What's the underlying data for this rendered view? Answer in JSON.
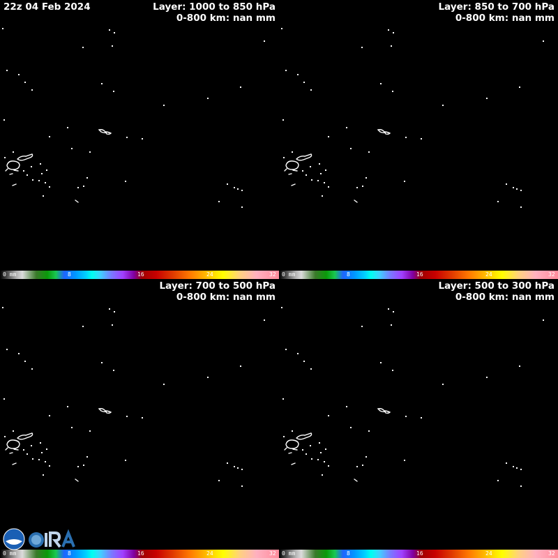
{
  "timestamp": "22z 04 Feb 2024",
  "colorbar": {
    "unit": "0 mm",
    "ticks": [
      "8",
      "16",
      "24",
      "32"
    ]
  },
  "panels": [
    {
      "layer": "Layer: 1000 to 850 hPa",
      "summary": "0-800 km: nan mm"
    },
    {
      "layer": "Layer: 850 to 700 hPa",
      "summary": "0-800 km: nan mm"
    },
    {
      "layer": "Layer: 700 to 500 hPa",
      "summary": "0-800 km: nan mm"
    },
    {
      "layer": "Layer: 500 to 300 hPa",
      "summary": "0-800 km: nan mm"
    }
  ],
  "logos": [
    "noaa-logo",
    "cira-logo"
  ]
}
